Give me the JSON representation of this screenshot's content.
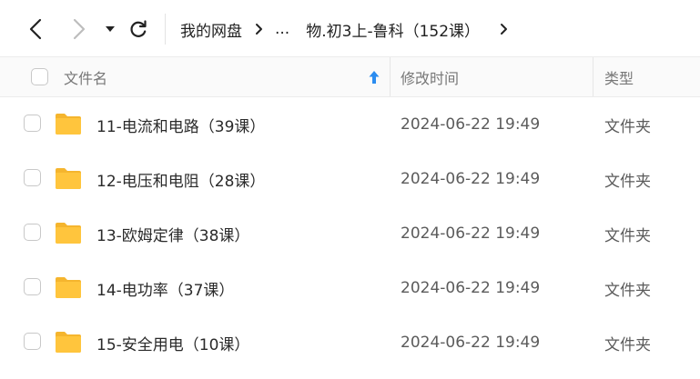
{
  "breadcrumb": {
    "root": "我的网盘",
    "ellipsis": "...",
    "current": "物.初3上-鲁科（152课）"
  },
  "icons": {
    "back": "chevron-left-icon",
    "forward": "chevron-right-icon",
    "dropdown": "caret-down-icon",
    "refresh": "refresh-icon",
    "folder": "folder-icon",
    "sort": "sort-ascending-icon"
  },
  "colors": {
    "folder": "#FFC53D",
    "sort_arrow": "#2B8CF0"
  },
  "table": {
    "columns": {
      "name": "文件名",
      "modified": "修改时间",
      "type": "类型"
    },
    "rows": [
      {
        "name": "11-电流和电路（39课）",
        "modified": "2024-06-22 19:49",
        "type": "文件夹"
      },
      {
        "name": "12-电压和电阻（28课）",
        "modified": "2024-06-22 19:49",
        "type": "文件夹"
      },
      {
        "name": "13-欧姆定律（38课）",
        "modified": "2024-06-22 19:49",
        "type": "文件夹"
      },
      {
        "name": "14-电功率（37课）",
        "modified": "2024-06-22 19:49",
        "type": "文件夹"
      },
      {
        "name": "15-安全用电（10课）",
        "modified": "2024-06-22 19:49",
        "type": "文件夹"
      }
    ]
  }
}
